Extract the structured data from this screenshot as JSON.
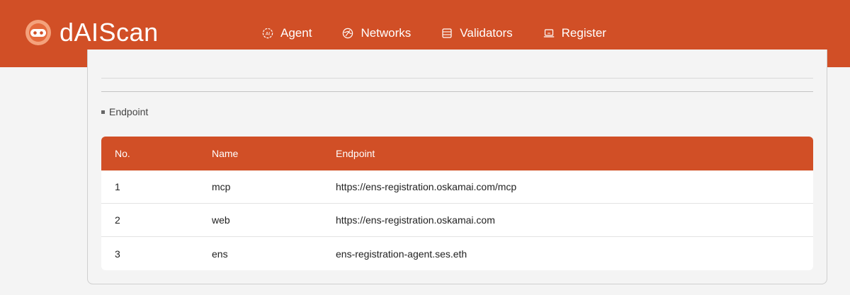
{
  "header": {
    "brand": "dAIScan",
    "nav": [
      {
        "label": "Agent",
        "icon": "ai-icon"
      },
      {
        "label": "Networks",
        "icon": "globe-icon"
      },
      {
        "label": "Validators",
        "icon": "server-icon"
      },
      {
        "label": "Register",
        "icon": "laptop-icon"
      }
    ]
  },
  "section": {
    "label": "Endpoint"
  },
  "table": {
    "columns": [
      "No.",
      "Name",
      "Endpoint"
    ],
    "rows": [
      {
        "no": "1",
        "name": "mcp",
        "endpoint": "https://ens-registration.oskamai.com/mcp"
      },
      {
        "no": "2",
        "name": "web",
        "endpoint": "https://ens-registration.oskamai.com"
      },
      {
        "no": "3",
        "name": "ens",
        "endpoint": "ens-registration-agent.ses.eth"
      }
    ]
  },
  "colors": {
    "brand": "#d14f26",
    "background": "#f4f4f4"
  }
}
